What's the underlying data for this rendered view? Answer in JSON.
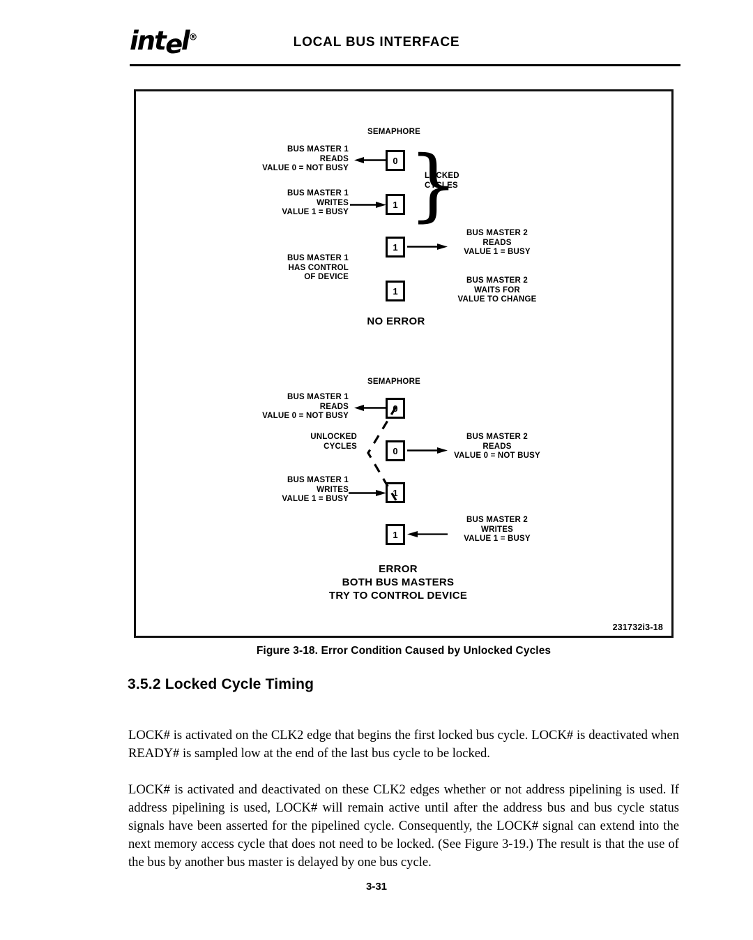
{
  "header": {
    "logo_text": "intel",
    "logo_registered": "®",
    "title": "LOCAL BUS INTERFACE"
  },
  "figure": {
    "id_code": "231732i3-18",
    "caption": "Figure 3-18. Error Condition Caused by Unlocked Cycles",
    "locked_diagram": {
      "semaphore_label": "SEMAPHORE",
      "bracket_label": "LOCKED\nCYCLES",
      "conclusion": "NO ERROR",
      "boxes": [
        {
          "value": "0"
        },
        {
          "value": "1"
        },
        {
          "value": "1"
        },
        {
          "value": "1"
        }
      ],
      "labels": {
        "master1_reads": "BUS MASTER 1\nREADS\nVALUE 0 = NOT BUSY",
        "master1_writes": "BUS MASTER 1\nWRITES\nVALUE 1 = BUSY",
        "master1_control": "BUS MASTER 1\nHAS CONTROL\nOF DEVICE",
        "master2_reads": "BUS MASTER 2\nREADS\nVALUE 1 = BUSY",
        "master2_waits": "BUS MASTER 2\nWAITS FOR\nVALUE TO CHANGE"
      }
    },
    "unlocked_diagram": {
      "semaphore_label": "SEMAPHORE",
      "bracket_label": "UNLOCKED\nCYCLES",
      "conclusion": "ERROR\nBOTH BUS MASTERS\nTRY TO CONTROL DEVICE",
      "boxes": [
        {
          "value": "0"
        },
        {
          "value": "0"
        },
        {
          "value": "1"
        },
        {
          "value": "1"
        }
      ],
      "labels": {
        "master1_reads": "BUS MASTER 1\nREADS\nVALUE 0 = NOT BUSY",
        "master2_reads": "BUS MASTER 2\nREADS\nVALUE 0 = NOT BUSY",
        "master1_writes": "BUS MASTER 1\nWRITES\nVALUE 1 = BUSY",
        "master2_writes": "BUS MASTER 2\nWRITES\nVALUE 1 = BUSY"
      }
    }
  },
  "section": {
    "heading": "3.5.2  Locked Cycle Timing",
    "paragraph_1": "LOCK# is activated on the CLK2 edge that begins the first locked bus cycle. LOCK# is deactivated when READY# is sampled low at the end of the last bus cycle to be locked.",
    "paragraph_2": "LOCK# is activated and deactivated on these CLK2 edges whether or not address pipelining is used. If address pipelining is used, LOCK# will remain active until after the address bus and bus cycle status signals have been asserted for the pipelined cycle. Consequently, the LOCK# signal can extend into the next memory access cycle that does not need to be locked. (See Figure 3-19.) The result is that the use of the bus by another bus master is delayed by one bus cycle."
  },
  "footer": {
    "page_number": "3-31"
  }
}
